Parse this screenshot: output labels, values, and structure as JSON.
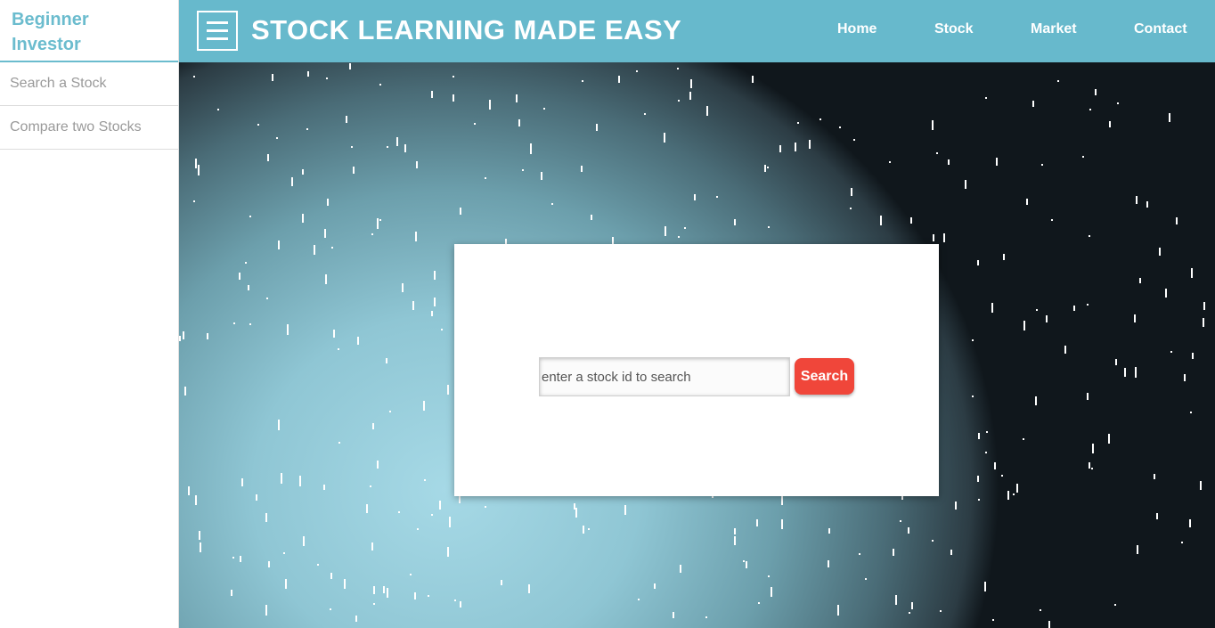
{
  "sidebar": {
    "brand": "Beginner Investor",
    "items": [
      {
        "label": "Search a Stock"
      },
      {
        "label": "Compare two Stocks"
      }
    ]
  },
  "header": {
    "title": "STOCK LEARNING MADE EASY",
    "menu_icon": "hamburger-menu-icon",
    "nav": [
      {
        "label": "Home"
      },
      {
        "label": "Stock"
      },
      {
        "label": "Market"
      },
      {
        "label": "Contact"
      }
    ]
  },
  "search": {
    "placeholder": "enter a stock id to search",
    "value": "",
    "button_label": "Search"
  },
  "colors": {
    "brand": "#6bbcce",
    "header_bg": "#67b9cc",
    "search_button": "#f0463a"
  }
}
